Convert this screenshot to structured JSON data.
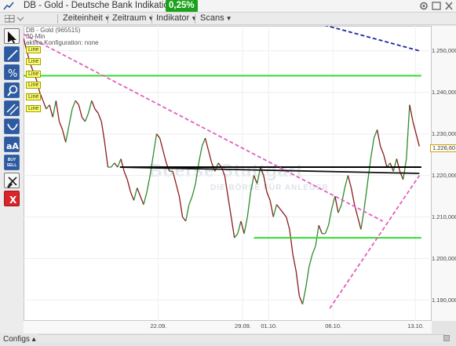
{
  "window": {
    "title": "DB - Gold - Deutsche Bank Indikation",
    "change": "0,25%",
    "colors": {
      "change_badge": "#1aa31a",
      "accent": "#2d5aa0"
    }
  },
  "menu": {
    "items": [
      {
        "label": "Zeiteinheit"
      },
      {
        "label": "Zeitraum"
      },
      {
        "label": "Indikator"
      },
      {
        "label": "Scans"
      }
    ]
  },
  "toolbar": {
    "tools": [
      {
        "name": "cursor-tool-icon"
      },
      {
        "name": "trendline-tool-icon"
      },
      {
        "name": "percent-tool-icon"
      },
      {
        "name": "zoom-tool-icon"
      },
      {
        "name": "parallel-lines-tool-icon"
      },
      {
        "name": "arc-tool-icon"
      },
      {
        "name": "text-size-tool-icon",
        "label": "aA"
      },
      {
        "name": "buy-sell-tool-icon",
        "label_top": "BUY",
        "label_bottom": "SELL"
      },
      {
        "name": "delete-tool-icon"
      },
      {
        "name": "close-tool-icon",
        "label": "X"
      }
    ]
  },
  "chart_info": {
    "instrument": "DB - Gold (965515)",
    "interval": "30-Min",
    "config": "aktive Konfiguration: none"
  },
  "line_tags": [
    "Line",
    "Line",
    "Line",
    "Line",
    "Line",
    "Line"
  ],
  "watermark": {
    "main": "Boerse Stuttgart",
    "sub": "DIE BÖRSE FÜR ANLEGER"
  },
  "current_price": "1.226,60",
  "configs_label": "Configs",
  "chart_data": {
    "type": "line",
    "title": "DB - Gold (965515)",
    "interval": "30-Min",
    "x_ticks": [
      "22.09.",
      "29.09.",
      "01.10.",
      "06.10.",
      "13.10."
    ],
    "y_ticks": [
      "1.250,000",
      "1.240,000",
      "1.230,000",
      "1.220,000",
      "1.210,000",
      "1.200,000",
      "1.190,000"
    ],
    "ylim": [
      1185,
      1256
    ],
    "grid": true,
    "current_price": 1226.6,
    "series": [
      {
        "values": [
          1253,
          1250,
          1247,
          1245,
          1243,
          1240,
          1238,
          1236,
          1237,
          1234,
          1238,
          1233,
          1231,
          1228,
          1232,
          1236,
          1238,
          1237,
          1234,
          1233,
          1235,
          1238,
          1236,
          1235,
          1233,
          1228,
          1222,
          1222,
          1223,
          1222,
          1224,
          1221,
          1219,
          1216,
          1214,
          1217,
          1215,
          1213,
          1216,
          1220,
          1225,
          1230,
          1229,
          1226,
          1223,
          1221,
          1221,
          1218,
          1215,
          1210,
          1209,
          1213,
          1215,
          1218,
          1223,
          1227,
          1229,
          1226,
          1223,
          1221,
          1223,
          1222,
          1220,
          1215,
          1210,
          1205,
          1206,
          1209,
          1206,
          1210,
          1216,
          1220,
          1218,
          1222,
          1220,
          1216,
          1214,
          1210,
          1213,
          1212,
          1211,
          1210,
          1207,
          1201,
          1197,
          1191,
          1189,
          1193,
          1198,
          1201,
          1203,
          1208,
          1206,
          1206,
          1208,
          1212,
          1215,
          1211,
          1213,
          1217,
          1220,
          1217,
          1213,
          1210,
          1207,
          1212,
          1218,
          1224,
          1229,
          1231,
          1227,
          1225,
          1222,
          1223,
          1221,
          1224,
          1221,
          1219,
          1224,
          1237,
          1233,
          1230,
          1227
        ]
      }
    ],
    "horizontal_lines": [
      {
        "y": 1244,
        "color": "#33dd33",
        "x_start": 0
      },
      {
        "y": 1205,
        "color": "#33dd33",
        "x_start": 0.573
      },
      {
        "y": 1222,
        "color": "#000000",
        "x_start": 0.24
      }
    ],
    "trend_lines": [
      {
        "color": "#e060c0",
        "style": "dashed",
        "from": [
          0,
          1254
        ],
        "to": [
          0.894,
          1209
        ]
      },
      {
        "color": "#e060c0",
        "style": "dashed",
        "from": [
          0.762,
          1188
        ],
        "to": [
          0.985,
          1220
        ]
      },
      {
        "color": "#1a2a9c",
        "style": "dashed",
        "from": [
          0.718,
          1257
        ],
        "to": [
          0.985,
          1250
        ]
      },
      {
        "color": "#111111",
        "style": "solid",
        "from": [
          0.24,
          1222
        ],
        "to": [
          0.985,
          1220.5
        ]
      }
    ]
  }
}
